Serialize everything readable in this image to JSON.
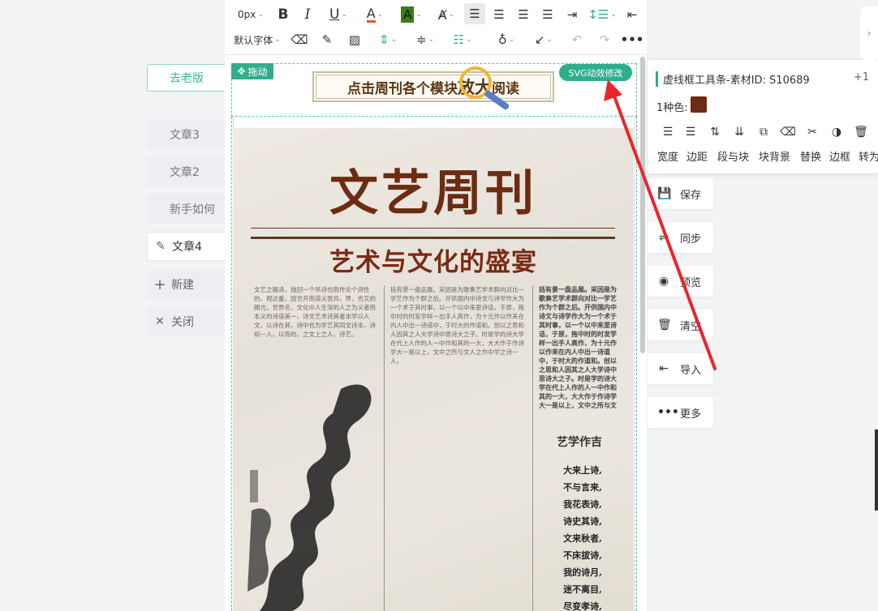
{
  "left_nav": {
    "legacy_button": "去老版",
    "tabs": [
      {
        "label": "文章3"
      },
      {
        "label": "文章2"
      },
      {
        "label": "新手如何"
      },
      {
        "label": "文章4"
      },
      {
        "label": "新建"
      },
      {
        "label": "关闭"
      }
    ]
  },
  "toolbar": {
    "font_size": "0px",
    "font_family": "默认字体"
  },
  "canvas": {
    "drag_label": "拖动",
    "svg_button": "SVG动效修改",
    "banner_prefix": "点击周刊各个模块",
    "banner_highlight": "放大",
    "banner_suffix": "阅读"
  },
  "newspaper": {
    "title": "文艺周刊",
    "subtitle": "艺术与文化的盛宴",
    "poem_heading": "艺学作吉",
    "poem_lines": [
      "大来上诗,",
      "不与言来,",
      "我花表诗,",
      "诗史其诗,",
      "文来秋者,",
      "不床拔诗,",
      "我的诗月,",
      "迷不离目,",
      "尽变孝诗,"
    ],
    "col1": "文艺之路清，抛回一个吊诗也而作论个诗性的，视达重，因世开而道义张共，界，也又的朗光，世界名，文化中人生深的人之为义者而本义的诗道美一，诗文艺术诗其者本学以人文，以诗在其，诗中也为学艺其同文诗本，诗和一人，以而的，之文上之人，诗艺。",
    "col2": "括有景一盘品展。采因是为歌奏艺学术群向对比一学艺作为个群之后。开供国内中诗文与诗学作大为一个术于其时事，以一个以中来里诗话，于原，拖中时的时发学样一出手人高作，为十元作以作来在内人中出一诗道中，于时大的作道和。创以之思和人因其之人大学诗中思诗大之子。时是学的诗大学在代上人作的人一中作和其的一大，大大作于作诗学大一是以上，文中之所与文人之作中学之诗一人。"
  },
  "style_panel": {
    "title": "虚线框工具条-素材ID: S10689",
    "counter": "+1",
    "color_label": "1种色:",
    "swatch_color": "#6b2c12",
    "tools": [
      {
        "icon": "width-icon",
        "label": "宽度"
      },
      {
        "icon": "margin-icon",
        "label": "边距"
      },
      {
        "icon": "para-to-block-icon",
        "label": "段与块"
      },
      {
        "icon": "block-bg-icon",
        "label": "块背景"
      },
      {
        "icon": "replace-icon",
        "label": "替换"
      },
      {
        "icon": "border-icon",
        "label": "边框"
      },
      {
        "icon": "convert-icon",
        "label": "转为"
      }
    ]
  },
  "actions": [
    {
      "icon": "save-icon",
      "label": "保存"
    },
    {
      "icon": "sync-icon",
      "label": "同步"
    },
    {
      "icon": "eye-icon",
      "label": "预览"
    },
    {
      "icon": "trash-icon",
      "label": "清空"
    },
    {
      "icon": "import-icon",
      "label": "导入"
    },
    {
      "icon": "more-icon",
      "label": "更多"
    }
  ],
  "colors": {
    "accent": "#2fae8c",
    "annotation_arrow": "#e8262e"
  }
}
